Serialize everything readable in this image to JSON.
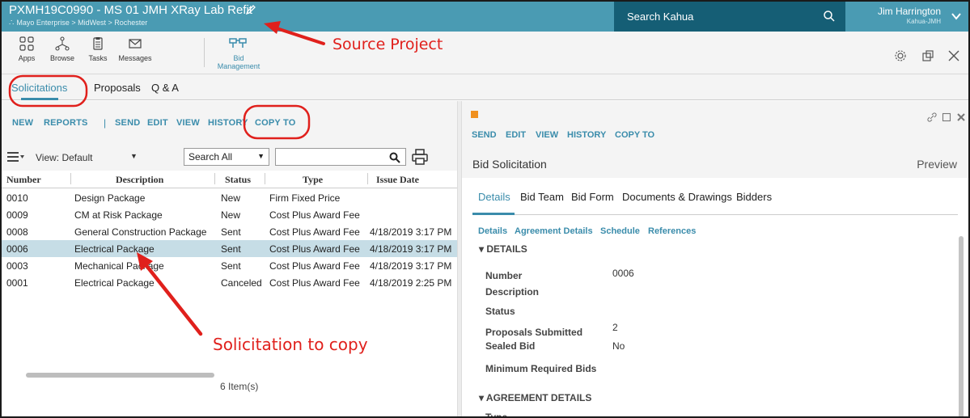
{
  "header": {
    "project_title": "PXMH19C0990 - MS 01 JMH XRay Lab Refit",
    "breadcrumb": "Mayo Enterprise > MidWest > Rochester",
    "search_label": "Search Kahua",
    "user_name": "Jim Harrington",
    "user_org": "Kahua-JMH"
  },
  "apps": [
    {
      "label": "Apps",
      "icon": "apps-grid-icon"
    },
    {
      "label": "Browse",
      "icon": "browse-icon"
    },
    {
      "label": "Tasks",
      "icon": "tasks-icon"
    },
    {
      "label": "Messages",
      "icon": "messages-icon"
    },
    {
      "label": "Bid Management",
      "icon": "bid-management-icon",
      "active": true
    }
  ],
  "tabs": [
    {
      "label": "Solicitations",
      "active": true
    },
    {
      "label": "Proposals"
    },
    {
      "label": "Q & A"
    }
  ],
  "list": {
    "actions": [
      "NEW",
      "REPORTS",
      "SEND",
      "EDIT",
      "VIEW",
      "HISTORY",
      "COPY TO"
    ],
    "view_label": "View: Default",
    "search_scope": "Search All",
    "search_value": "",
    "columns": [
      "Number",
      "Description",
      "Status",
      "Type",
      "Issue Date"
    ],
    "rows": [
      {
        "number": "0010",
        "description": "Design Package",
        "status": "New",
        "type": "Firm Fixed Price",
        "issue_date": ""
      },
      {
        "number": "0009",
        "description": "CM at Risk Package",
        "status": "New",
        "type": "Cost Plus Award Fee",
        "issue_date": ""
      },
      {
        "number": "0008",
        "description": "General Construction Package",
        "status": "Sent",
        "type": "Cost Plus Award Fee",
        "issue_date": "4/18/2019 3:17 PM"
      },
      {
        "number": "0006",
        "description": "Electrical Package",
        "status": "Sent",
        "type": "Cost Plus Award Fee",
        "issue_date": "4/18/2019 3:17 PM",
        "selected": true
      },
      {
        "number": "0003",
        "description": "Mechanical Package",
        "status": "Sent",
        "type": "Cost Plus Award Fee",
        "issue_date": "4/18/2019 3:17 PM"
      },
      {
        "number": "0001",
        "description": "Electrical Package",
        "status": "Canceled",
        "type": "Cost Plus Award Fee",
        "issue_date": "4/18/2019 2:25 PM"
      }
    ],
    "item_count": "6 Item(s)"
  },
  "detail": {
    "actions": [
      "SEND",
      "EDIT",
      "VIEW",
      "HISTORY",
      "COPY TO"
    ],
    "title": "Bid Solicitation",
    "preview": "Preview",
    "tabs": [
      "Details",
      "Bid Team",
      "Bid Form",
      "Documents & Drawings",
      "Bidders"
    ],
    "subtabs": [
      "Details",
      "Agreement Details",
      "Schedule",
      "References"
    ],
    "section_details": "▾ DETAILS",
    "fields": [
      {
        "label": "Number",
        "value": "0006"
      },
      {
        "label": "Description",
        "value": ""
      },
      {
        "label": "Status",
        "value": ""
      },
      {
        "label": "Proposals Submitted",
        "value": "2"
      },
      {
        "label": "Sealed Bid",
        "value": "No"
      },
      {
        "label": "Minimum Required Bids",
        "value": ""
      }
    ],
    "section_agreement": "▾ AGREEMENT DETAILS",
    "next_field": "Type"
  },
  "annotations": {
    "source_project": "Source Project",
    "solicitation_to_copy": "Solicitation to copy",
    "color": "#e0201c"
  },
  "colors": {
    "header_bg": "#4a9bb3",
    "search_bg": "#155e75",
    "accent": "#3a8cab",
    "selected_row": "#c6dde6",
    "status_square": "#f0901e"
  }
}
